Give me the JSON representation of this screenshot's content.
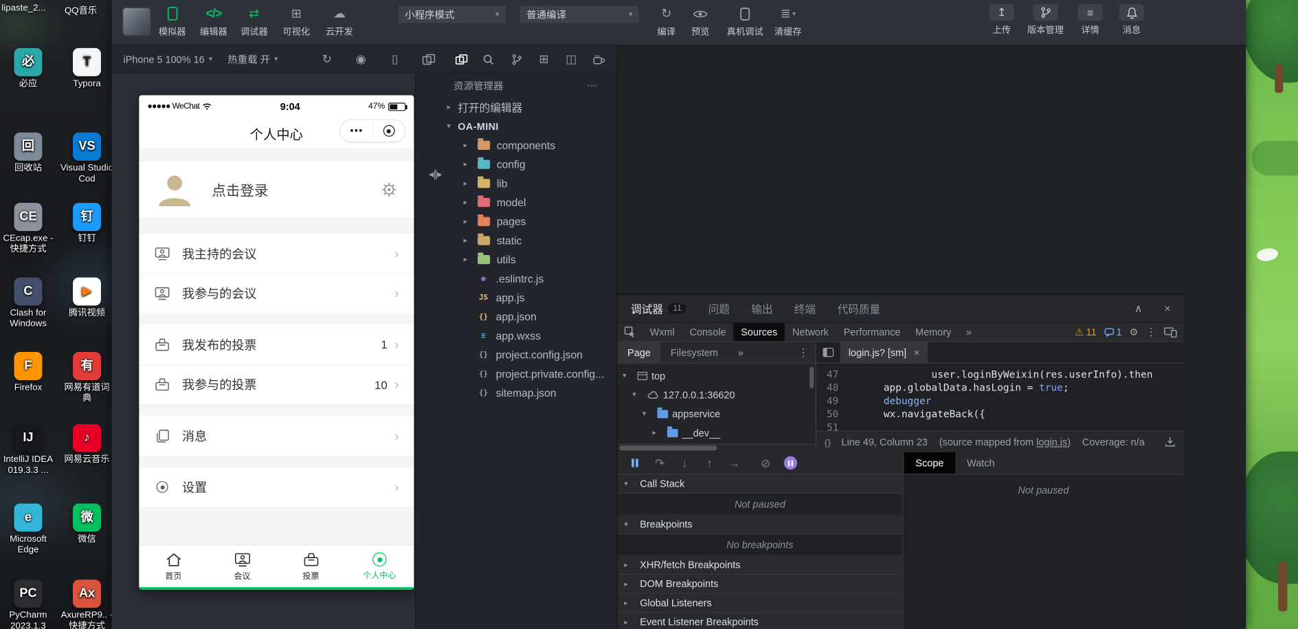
{
  "desktop": {
    "top_labels": [
      "lipaste_2...",
      "QQ音乐"
    ],
    "icons": [
      {
        "label": "必应",
        "abbr": "必",
        "color": "#2aa7a8"
      },
      {
        "label": "Typora",
        "abbr": "T",
        "color": "#f5f6f8",
        "text": "#23262b"
      },
      {
        "label": "回收站",
        "abbr": "回",
        "color": "#7d8a99"
      },
      {
        "label": "Visual Studio Cod",
        "abbr": "VS",
        "color": "#0a7bd4"
      },
      {
        "label": "CEcap.exe - 快捷方式",
        "abbr": "CE",
        "color": "#8d939c"
      },
      {
        "label": "钉钉",
        "abbr": "钉",
        "color": "#1e9bff"
      },
      {
        "label": "Clash for Windows",
        "abbr": "C",
        "color": "#44506b"
      },
      {
        "label": "腾讯视频",
        "abbr": "▶",
        "color": "#ffffff",
        "text": "#ff7a00"
      },
      {
        "label": "Firefox",
        "abbr": "F",
        "color": "#ff9400"
      },
      {
        "label": "网易有道词典",
        "abbr": "有",
        "color": "#e23c39"
      },
      {
        "label": "IntelliJ IDEA 019.3.3 ...",
        "abbr": "IJ",
        "color": "#17181c"
      },
      {
        "label": "网易云音乐",
        "abbr": "♪",
        "color": "#e60026"
      },
      {
        "label": "Microsoft Edge",
        "abbr": "e",
        "color": "#35b6d9"
      },
      {
        "label": "微信",
        "abbr": "微",
        "color": "#07c160"
      },
      {
        "label": "PyCharm 2023.1.3",
        "abbr": "PC",
        "color": "#2b2d31"
      },
      {
        "label": "AxureRP9.. - 快捷方式",
        "abbr": "Ax",
        "color": "#d9533f"
      }
    ]
  },
  "toolbar": {
    "nav": [
      {
        "label": "模拟器"
      },
      {
        "label": "编辑器"
      },
      {
        "label": "调试器"
      },
      {
        "label": "可视化"
      },
      {
        "label": "云开发"
      }
    ],
    "mode_select": "小程序模式",
    "compile_select": "普通编译",
    "actions": [
      {
        "label": "编译"
      },
      {
        "label": "预览"
      },
      {
        "label": "真机调试"
      },
      {
        "label": "清缓存"
      }
    ],
    "right": [
      {
        "label": "上传"
      },
      {
        "label": "版本管理"
      },
      {
        "label": "详情"
      },
      {
        "label": "消息"
      }
    ]
  },
  "devicebar": {
    "device_label": "iPhone 5 100% 16",
    "hot_reload_label": "热重载 开"
  },
  "simulator": {
    "status": {
      "carrier": "●●●●● WeChat",
      "time": "9:04",
      "battery": "47%"
    },
    "nav_title": "个人中心",
    "login_label": "点击登录",
    "menu": [
      {
        "label": "我主持的会议",
        "badge": ""
      },
      {
        "label": "我参与的会议",
        "badge": ""
      },
      {
        "label": "我发布的投票",
        "badge": "1"
      },
      {
        "label": "我参与的投票",
        "badge": "10"
      },
      {
        "label": "消息",
        "badge": ""
      },
      {
        "label": "设置",
        "badge": ""
      }
    ],
    "tabbar": [
      {
        "label": "首页"
      },
      {
        "label": "会议"
      },
      {
        "label": "投票"
      },
      {
        "label": "个人中心"
      }
    ],
    "accent": "#07c160"
  },
  "explorer": {
    "title": "资源管理器",
    "open_editors_label": "打开的编辑器",
    "project_label": "OA-MINI",
    "items": [
      {
        "name": "components",
        "type": "folder",
        "color": "#d19a66"
      },
      {
        "name": "config",
        "type": "folder",
        "color": "#56b6c2"
      },
      {
        "name": "lib",
        "type": "folder",
        "color": "#d8b56a"
      },
      {
        "name": "model",
        "type": "folder",
        "color": "#e06c75"
      },
      {
        "name": "pages",
        "type": "folder",
        "color": "#e0825c"
      },
      {
        "name": "static",
        "type": "folder",
        "color": "#c8a96a"
      },
      {
        "name": "utils",
        "type": "folder",
        "color": "#98c379"
      },
      {
        "name": ".eslintrc.js",
        "type": "file",
        "glyph": "◉",
        "color": "#a57de0"
      },
      {
        "name": "app.js",
        "type": "file",
        "glyph": "JS",
        "color": "#e5c07b"
      },
      {
        "name": "app.json",
        "type": "file",
        "glyph": "{}",
        "color": "#e5c07b"
      },
      {
        "name": "app.wxss",
        "type": "file",
        "glyph": "≡",
        "color": "#61afef"
      },
      {
        "name": "project.config.json",
        "type": "file",
        "glyph": "{}",
        "color": "#9aa0a8"
      },
      {
        "name": "project.private.config...",
        "type": "file",
        "glyph": "{}",
        "color": "#9aa0a8"
      },
      {
        "name": "sitemap.json",
        "type": "file",
        "glyph": "{}",
        "color": "#9aa0a8"
      }
    ]
  },
  "debugger": {
    "panel_tabs": [
      {
        "label": "调试器",
        "badge": "11"
      },
      {
        "label": "问题"
      },
      {
        "label": "输出"
      },
      {
        "label": "终端"
      },
      {
        "label": "代码质量"
      }
    ],
    "devtools_tabs": [
      {
        "label": "Wxml"
      },
      {
        "label": "Console"
      },
      {
        "label": "Sources"
      },
      {
        "label": "Network"
      },
      {
        "label": "Performance"
      },
      {
        "label": "Memory"
      },
      {
        "label": "»"
      }
    ],
    "warning_count": "11",
    "message_count": "1",
    "sources": {
      "sidebar_tabs": [
        {
          "label": "Page"
        },
        {
          "label": "Filesystem"
        },
        {
          "label": "»"
        }
      ],
      "tree": [
        {
          "label": "top"
        },
        {
          "label": "127.0.0.1:36620"
        },
        {
          "label": "appservice"
        },
        {
          "label": "__dev__"
        }
      ],
      "file_tab": "login.js? [sm]",
      "lines": [
        {
          "num": "47",
          "text": "              user.loginByWeixin(res.userInfo).then"
        },
        {
          "num": "48",
          "pre": "      app.globalData.hasLogin = ",
          "atom": "true",
          "post": ";"
        },
        {
          "num": "49",
          "pre": "      ",
          "kw": "debugger"
        },
        {
          "num": "50",
          "text": "      wx.navigateBack({"
        },
        {
          "num": "51",
          "text": ""
        }
      ],
      "status_position": "Line 49, Column 23",
      "status_mapped_pre": "(source mapped from ",
      "status_mapped_link": "login.js",
      "status_mapped_post": ")",
      "status_coverage": "Coverage: n/a"
    },
    "scope_tabs": [
      {
        "label": "Scope"
      },
      {
        "label": "Watch"
      }
    ],
    "scope_empty": "Not paused",
    "sections": [
      {
        "label": "Call Stack",
        "body": "Not paused"
      },
      {
        "label": "Breakpoints",
        "body": "No breakpoints"
      },
      {
        "label": "XHR/fetch Breakpoints",
        "body": ""
      },
      {
        "label": "DOM Breakpoints",
        "body": ""
      },
      {
        "label": "Global Listeners",
        "body": ""
      },
      {
        "label": "Event Listener Breakpoints",
        "body": ""
      }
    ]
  }
}
